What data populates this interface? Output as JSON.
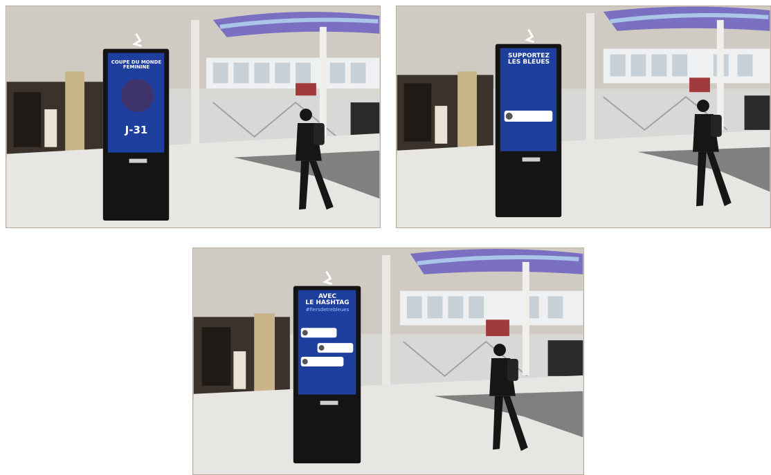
{
  "panels": [
    {
      "screen": {
        "headline_lines": [
          "COUPE DU MONDE",
          "FEMININE"
        ],
        "countdown": "J-31"
      }
    },
    {
      "screen": {
        "headline_lines": [
          "SUPPORTEZ",
          "LES BLEUES"
        ]
      }
    },
    {
      "screen": {
        "headline_lines": [
          "AVEC",
          "LE HASHTAG"
        ],
        "hashtag": "#fiersdetrebleues"
      }
    }
  ],
  "colors": {
    "screen_blue": "#1f3f9e",
    "kiosk_black": "#141414",
    "floor": "#e7e6e2",
    "dome_glass": "#6b5fbf"
  },
  "icons": [
    "person-walking",
    "kiosk-top-logo"
  ]
}
